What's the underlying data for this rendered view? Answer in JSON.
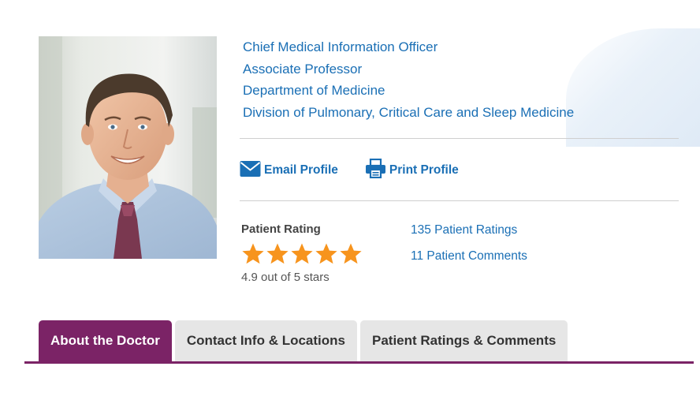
{
  "profile": {
    "titles": [
      "Chief Medical Information Officer",
      "Associate Professor",
      "Department of Medicine",
      "Division of Pulmonary, Critical Care and Sleep Medicine"
    ]
  },
  "actions": {
    "email_label": "Email Profile",
    "email_icon": "envelope-icon",
    "print_label": "Print Profile",
    "print_icon": "printer-icon"
  },
  "rating": {
    "label": "Patient Rating",
    "value": 4.9,
    "max": 5,
    "summary": "4.9 out of 5 stars",
    "star_color": "#f7941d",
    "ratings_link": "135 Patient Ratings",
    "comments_link": "11 Patient Comments"
  },
  "tabs": [
    {
      "label": "About the Doctor",
      "active": true
    },
    {
      "label": "Contact Info & Locations",
      "active": false
    },
    {
      "label": "Patient Ratings & Comments",
      "active": false
    }
  ],
  "colors": {
    "link": "#1a6fb5",
    "accent": "#7b2366",
    "tab_inactive": "#e6e6e6"
  }
}
